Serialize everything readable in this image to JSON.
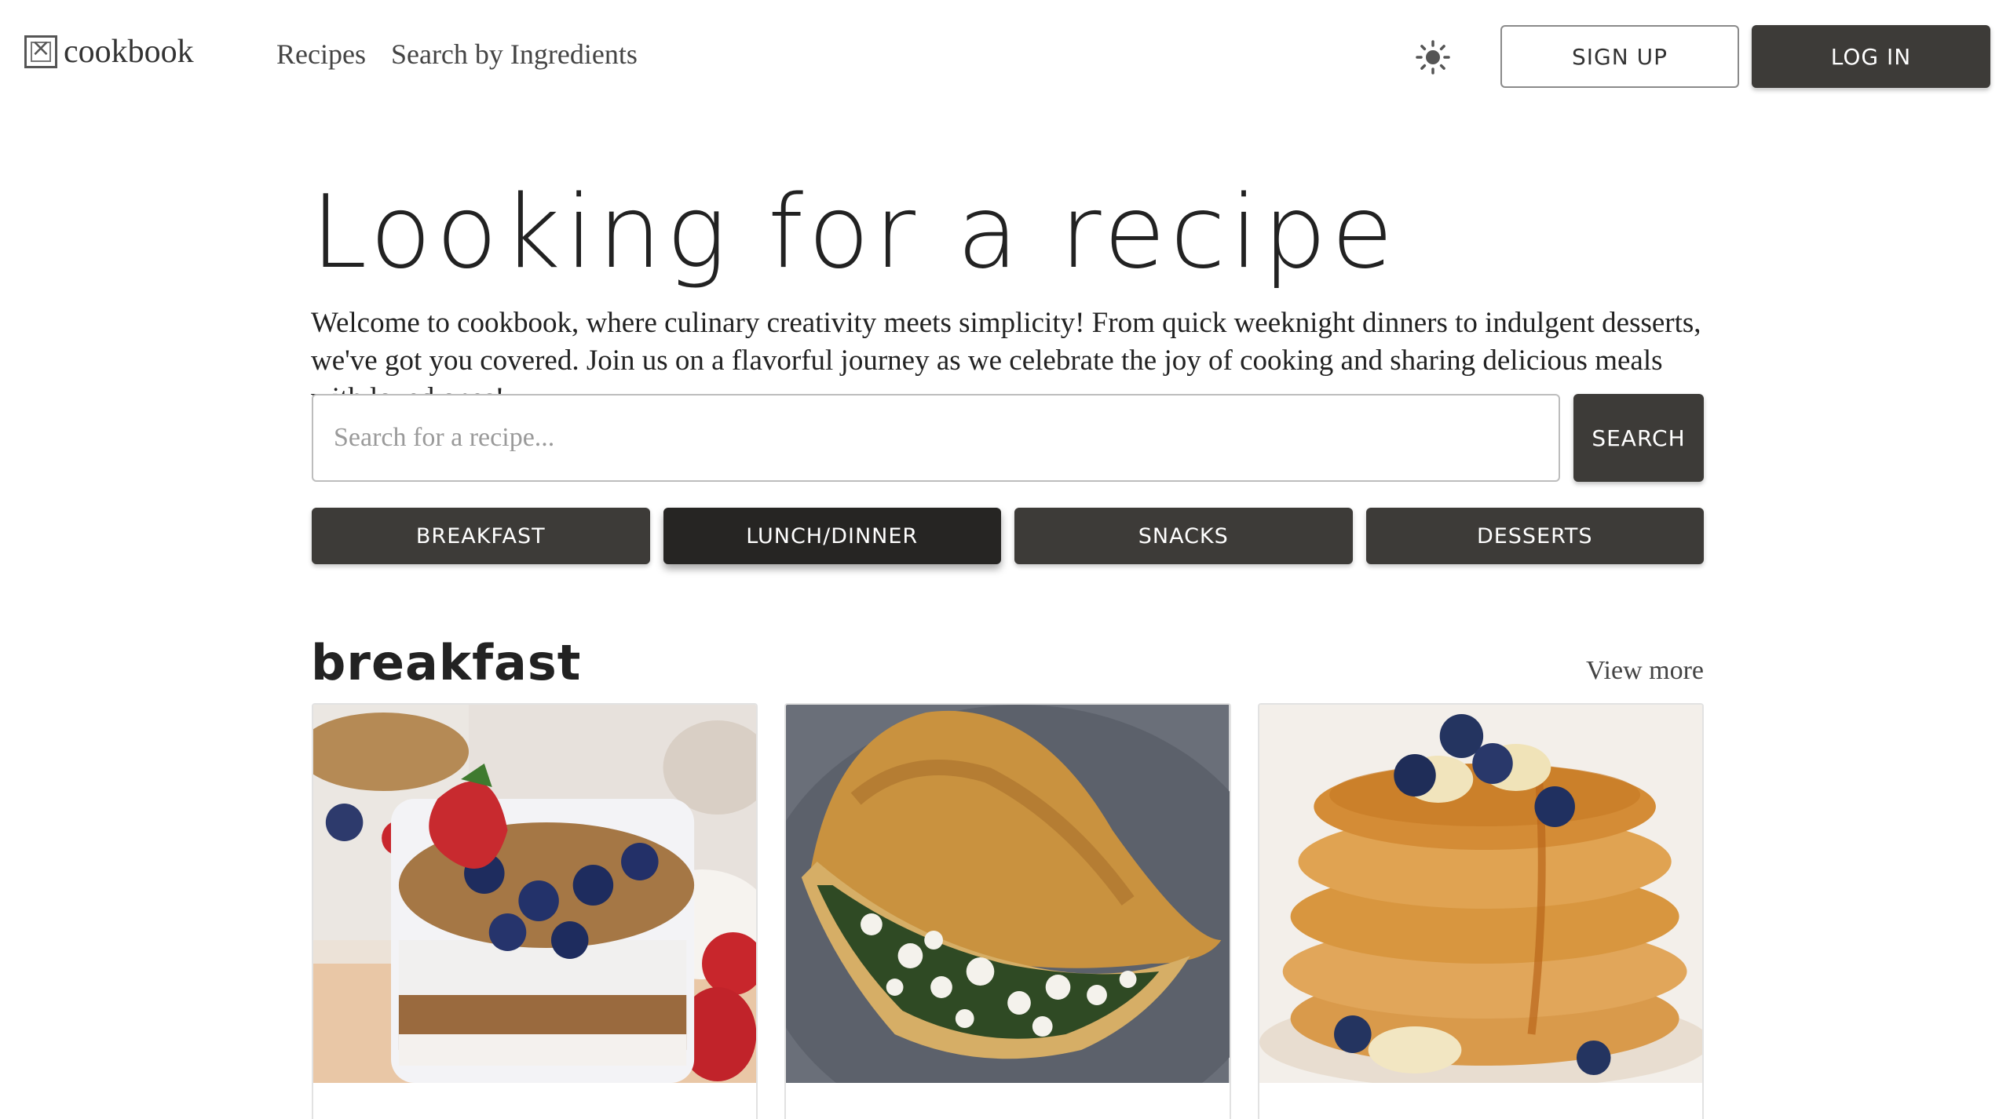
{
  "header": {
    "logo_text": "cookbook",
    "nav": [
      {
        "label": "Recipes"
      },
      {
        "label": "Search by Ingredients"
      }
    ],
    "theme_icon": "sun-icon",
    "signup_label": "SIGN UP",
    "login_label": "LOG IN"
  },
  "hero": {
    "title": "Looking for a recipe",
    "text": "Welcome to cookbook, where culinary creativity meets simplicity! From quick weeknight dinners to indulgent desserts, we've got you covered. Join us on a flavorful journey as we celebrate the joy of cooking and sharing delicious meals with loved ones!",
    "search_placeholder": "Search for a recipe...",
    "search_value": "",
    "search_button": "SEARCH"
  },
  "categories": [
    {
      "label": "BREAKFAST",
      "active": false
    },
    {
      "label": "LUNCH/DINNER",
      "active": true
    },
    {
      "label": "SNACKS",
      "active": false
    },
    {
      "label": "DESSERTS",
      "active": false
    }
  ],
  "section": {
    "title": "breakfast",
    "view_more": "View more",
    "cards": [
      {
        "image": "yogurt-parfait-image"
      },
      {
        "image": "spinach-feta-omelette-image"
      },
      {
        "image": "blueberry-banana-pancakes-image"
      }
    ]
  },
  "colors": {
    "primary_button": "#3d3b38",
    "active_button": "#262523",
    "text": "#222222"
  }
}
